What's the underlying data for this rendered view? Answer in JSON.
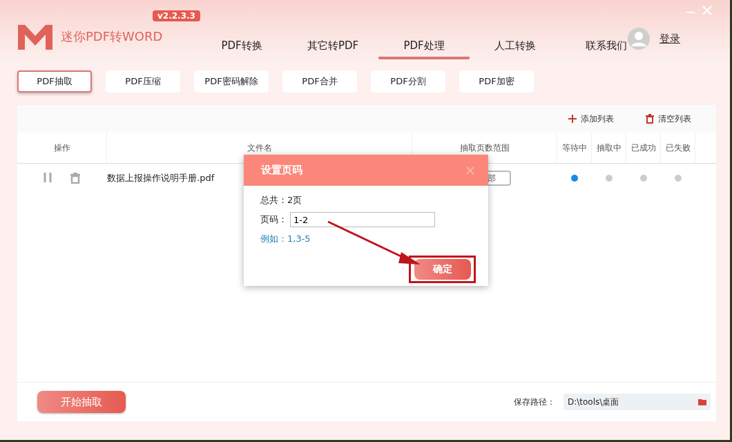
{
  "app": {
    "version": "v2.2.3.3",
    "name": "迷你PDF转WORD",
    "login": "登录"
  },
  "nav": [
    {
      "label": "PDF转换",
      "selected": false
    },
    {
      "label": "其它转PDF",
      "selected": false
    },
    {
      "label": "PDF处理",
      "selected": true
    },
    {
      "label": "人工转换",
      "selected": false
    },
    {
      "label": "联系我们",
      "selected": false
    }
  ],
  "subtabs": [
    {
      "label": "PDF抽取",
      "selected": true
    },
    {
      "label": "PDF压缩",
      "selected": false
    },
    {
      "label": "PDF密码解除",
      "selected": false
    },
    {
      "label": "PDF合并",
      "selected": false
    },
    {
      "label": "PDF分割",
      "selected": false
    },
    {
      "label": "PDF加密",
      "selected": false
    }
  ],
  "toolbar": {
    "add": "添加列表",
    "clear": "清空列表"
  },
  "table": {
    "columns": [
      "操作",
      "文件名",
      "抽取页数范围",
      "等待中",
      "抽取中",
      "已成功",
      "已失败"
    ],
    "rows": [
      {
        "file": "数据上报操作说明手册.pdf",
        "range": "部",
        "statuses": [
          {
            "color": "#1a88e6"
          },
          {
            "color": "#cccccc"
          },
          {
            "color": "#cccccc"
          },
          {
            "color": "#cccccc"
          }
        ]
      }
    ]
  },
  "dialog": {
    "title": "设置页码",
    "total": "总共：2页",
    "page_label": "页码：",
    "page_value": "1-2",
    "example": "例如：1,3-5",
    "ok": "确定"
  },
  "footer": {
    "start": "开始抽取",
    "save_label": "保存路径：",
    "save_path": "D:\\tools\\桌面"
  }
}
